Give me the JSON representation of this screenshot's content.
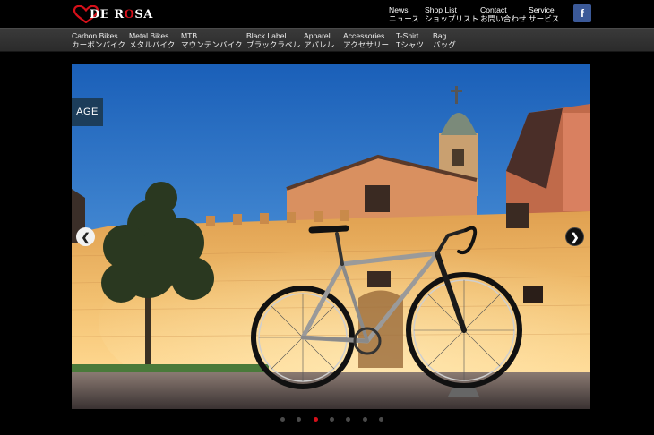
{
  "brand": {
    "logo_text_a": "DE R",
    "logo_text_o": "O",
    "logo_text_b": "SA",
    "accent_color": "#d6101a"
  },
  "top_nav": [
    {
      "en": "News",
      "ja": "ニュース"
    },
    {
      "en": "Shop List",
      "ja": "ショップリスト"
    },
    {
      "en": "Contact",
      "ja": "お問い合わせ"
    },
    {
      "en": "Service",
      "ja": "サービス"
    }
  ],
  "social": {
    "facebook_label": "f",
    "facebook_color": "#3b5998"
  },
  "categories": [
    {
      "en": "Carbon Bikes",
      "ja": "カーボンバイク"
    },
    {
      "en": "Metal Bikes",
      "ja": "メタルバイク"
    },
    {
      "en": "MTB",
      "ja": "マウンテンバイク"
    },
    {
      "en": "Black Label",
      "ja": "ブラックラベル"
    },
    {
      "en": "Apparel",
      "ja": "アパレル"
    },
    {
      "en": "Accessories",
      "ja": "アクセサリー"
    },
    {
      "en": "T-Shirt",
      "ja": "Tシャツ"
    },
    {
      "en": "Bag",
      "ja": "バッグ"
    }
  ],
  "slider": {
    "badge": "AGE",
    "prev_glyph": "❮",
    "next_glyph": "❯",
    "slide_count": 7,
    "active_index": 2
  }
}
